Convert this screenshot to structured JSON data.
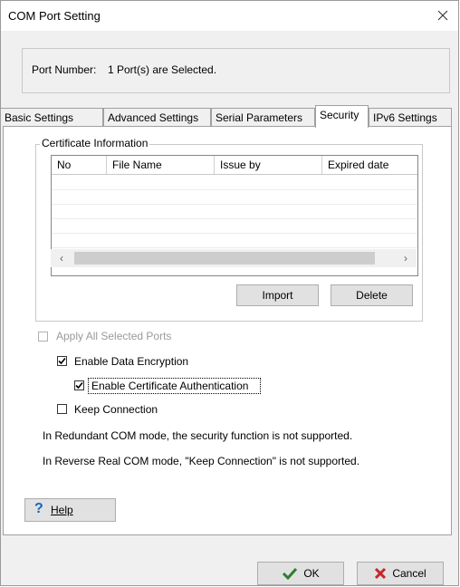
{
  "window": {
    "title": "COM Port Setting"
  },
  "port": {
    "label": "Port Number:",
    "value": "1 Port(s) are Selected."
  },
  "tabs": [
    {
      "label": "Basic Settings"
    },
    {
      "label": "Advanced Settings"
    },
    {
      "label": "Serial Parameters"
    },
    {
      "label": "Security",
      "active": true
    },
    {
      "label": "IPv6 Settings"
    }
  ],
  "certificate": {
    "group_title": "Certificate Information",
    "columns": [
      "No",
      "File Name",
      "Issue by",
      "Expired date"
    ],
    "rows": [],
    "import_label": "Import",
    "delete_label": "Delete"
  },
  "options": {
    "apply_all": {
      "label": "Apply All Selected Ports",
      "checked": false,
      "disabled": true
    },
    "enable_encryption": {
      "label": "Enable Data Encryption",
      "checked": true
    },
    "enable_cert_auth": {
      "label": "Enable Certificate Authentication",
      "checked": true
    },
    "keep_connection": {
      "label": "Keep Connection",
      "checked": false
    }
  },
  "notes": [
    "In Redundant COM mode,  the security function is not supported.",
    "In Reverse Real COM mode, \"Keep Connection\" is not supported."
  ],
  "buttons": {
    "help": "Help",
    "ok": "OK",
    "cancel": "Cancel"
  },
  "colors": {
    "check_ok": "#2e7d32",
    "cancel_x": "#c62828",
    "help_icon": "#1565c0"
  }
}
